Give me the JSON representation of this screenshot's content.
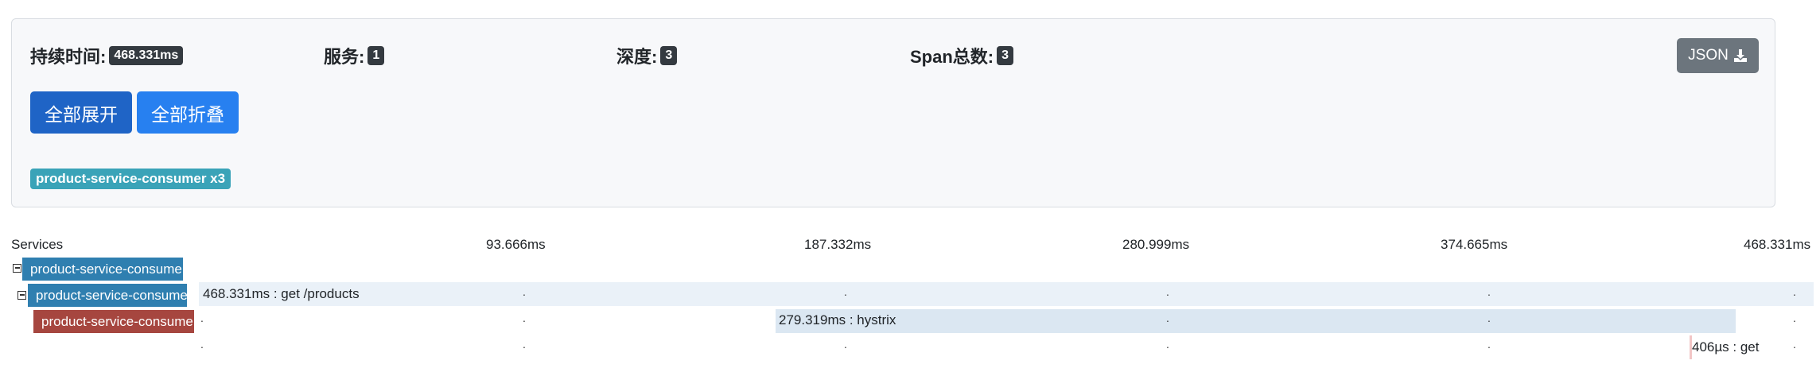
{
  "summary": {
    "duration_label": "持续时间:",
    "duration_value": "468.331ms",
    "services_label": "服务:",
    "services_value": "1",
    "depth_label": "深度:",
    "depth_value": "3",
    "span_total_label": "Span总数:",
    "span_total_value": "3",
    "json_button": "JSON",
    "expand_all": "全部展开",
    "collapse_all": "全部折叠",
    "service_tag": "product-service-consumer x3"
  },
  "timeline": {
    "services_header": "Services",
    "ticks": [
      "93.666ms",
      "187.332ms",
      "280.999ms",
      "374.665ms",
      "468.331ms"
    ],
    "rows": [
      {
        "service": "product-service-consumer",
        "label": "468.331ms : get /products",
        "color": "#2f7fb0"
      },
      {
        "service": "product-service-consumer",
        "label": "279.319ms : hystrix",
        "color": "#2f7fb0"
      },
      {
        "service": "product-service-consumer",
        "label": "406µs : get",
        "color": "#a6463f"
      }
    ]
  },
  "colors": {
    "expand": "#1f64c6",
    "collapse": "#2780f0",
    "json": "#6c757d",
    "service_tag": "#3aa3b8"
  }
}
